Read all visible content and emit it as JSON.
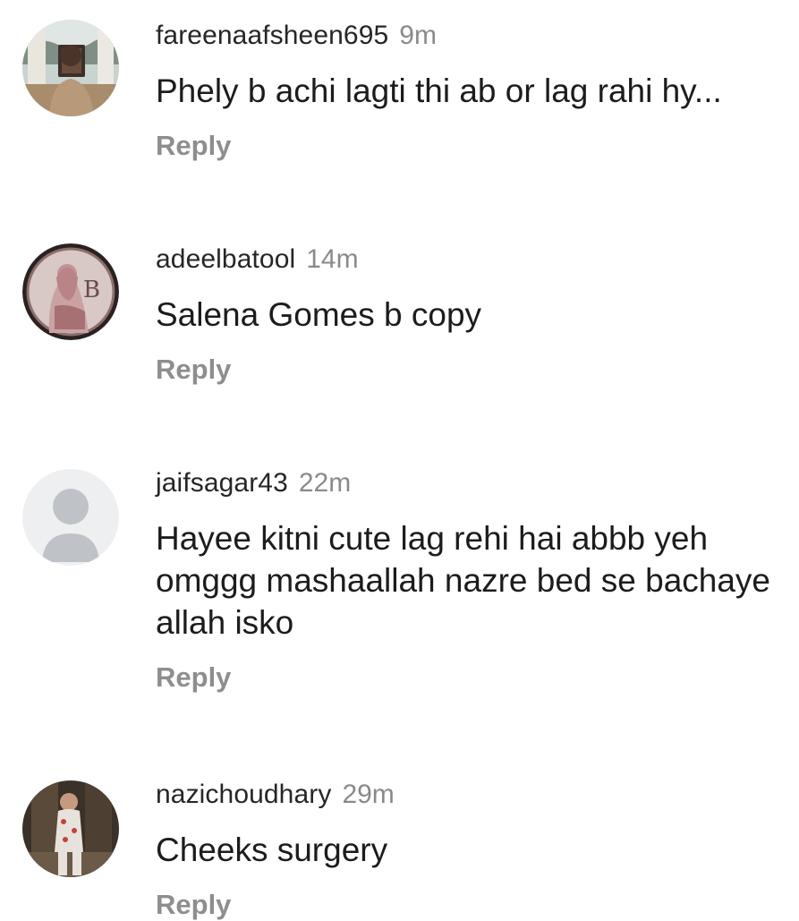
{
  "comments": [
    {
      "username": "fareenaafsheen695",
      "time": "9m",
      "text": "Phely b achi lagti thi ab or lag rahi hy...",
      "reply_label": "Reply",
      "avatar_icon": "profile-photo"
    },
    {
      "username": "adeelbatool",
      "time": "14m",
      "text": "Salena Gomes b copy",
      "reply_label": "Reply",
      "avatar_icon": "profile-photo"
    },
    {
      "username": "jaifsagar43",
      "time": "22m",
      "text": "Hayee kitni cute lag rehi hai abbb yeh omggg mashaallah nazre bed se bachaye allah isko",
      "reply_label": "Reply",
      "avatar_icon": "default-user-icon"
    },
    {
      "username": "nazichoudhary",
      "time": "29m",
      "text": "Cheeks surgery",
      "reply_label": "Reply",
      "avatar_icon": "profile-photo"
    }
  ],
  "colors": {
    "username": "#262626",
    "timestamp": "#8a8a8a",
    "reply": "#8e8e8e",
    "default_avatar_bg": "#eeeff1",
    "default_avatar_fg": "#bfc3c8"
  }
}
